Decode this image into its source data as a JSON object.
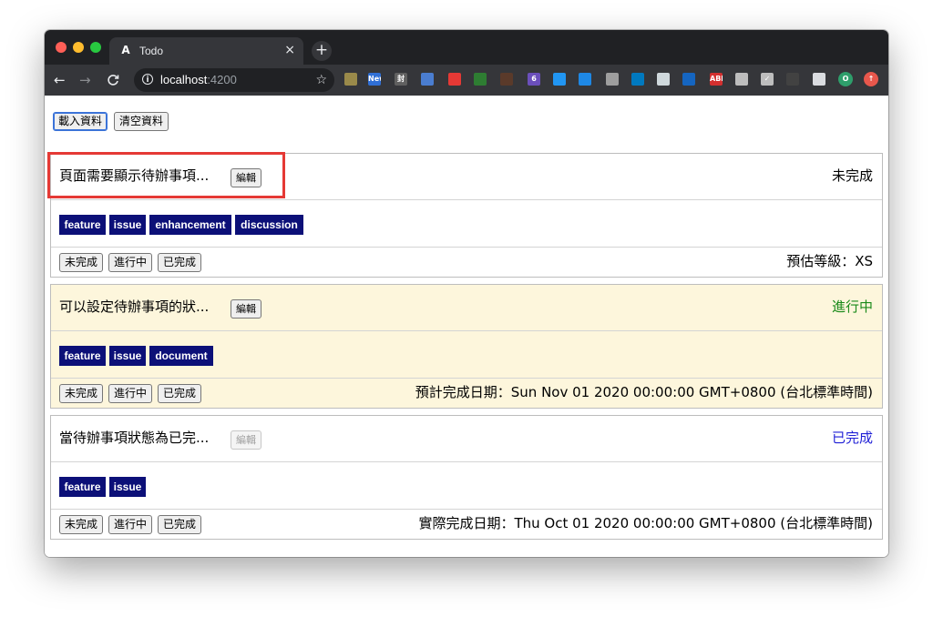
{
  "browser": {
    "tab": {
      "favicon": "angular-icon",
      "title": "Todo",
      "close": "×"
    },
    "new_tab": "+",
    "nav": {
      "back": "←",
      "forward": "→",
      "reload": "C"
    },
    "address": {
      "info": "i",
      "host": "localhost",
      "port": ":4200",
      "star": "☆"
    },
    "extensions": [
      {
        "name": "leaf-extension-icon",
        "color": "#9a8a4a",
        "label": ""
      },
      {
        "name": "new-badge-extension-icon",
        "color": "#2f6fd6",
        "label": "New"
      },
      {
        "name": "seal-extension-icon",
        "color": "#606060",
        "label": "封"
      },
      {
        "name": "card-extension-icon",
        "color": "#4a7dd0",
        "label": ""
      },
      {
        "name": "block-extension-icon",
        "color": "#e53935",
        "label": ""
      },
      {
        "name": "crop-extension-icon",
        "color": "#2e7d32",
        "label": ""
      },
      {
        "name": "cat-extension-icon",
        "color": "#5a3a2a",
        "label": ""
      },
      {
        "name": "puzzle-purple-extension-icon",
        "color": "#6b4fbb",
        "label": "6"
      },
      {
        "name": "stack-extension-icon",
        "color": "#2196f3",
        "label": ""
      },
      {
        "name": "screen-extension-icon",
        "color": "#1e88e5",
        "label": ""
      },
      {
        "name": "ghost-extension-icon",
        "color": "#9e9e9e",
        "label": ""
      },
      {
        "name": "trello-extension-icon",
        "color": "#0079bf",
        "label": ""
      },
      {
        "name": "bars-extension-icon",
        "color": "#cfd8dc",
        "label": ""
      },
      {
        "name": "trello-2-extension-icon",
        "color": "#1565c0",
        "label": ""
      },
      {
        "name": "abp-extension-icon",
        "color": "#d32f2f",
        "label": "ABP"
      },
      {
        "name": "photo-extension-icon",
        "color": "#bdbdbd",
        "label": ""
      },
      {
        "name": "check-extension-icon",
        "color": "#bdbdbd",
        "label": "✓"
      },
      {
        "name": "doc-extension-icon",
        "color": "#424242",
        "label": ""
      },
      {
        "name": "puzzle-extension-icon",
        "color": "#dadce0",
        "label": ""
      },
      {
        "name": "profile-avatar-icon",
        "color": "#2e9e6b",
        "label": "O"
      },
      {
        "name": "update-arrow-icon",
        "color": "#e8574c",
        "label": "↑"
      }
    ]
  },
  "toolbar": {
    "load_label": "載入資料",
    "clear_label": "清空資料"
  },
  "footer_labels": {
    "todo": "未完成",
    "doing": "進行中",
    "done": "已完成"
  },
  "edit_label": "編輯",
  "todos": [
    {
      "title": "頁面需要顯示待辦事項...",
      "status": "未完成",
      "status_color": "#000000",
      "tags": [
        "feature",
        "issue",
        "enhancement",
        "discussion"
      ],
      "info": "預估等級：XS",
      "edit_enabled": true
    },
    {
      "title": "可以設定待辦事項的狀...",
      "status": "進行中",
      "status_color": "#1a8a1a",
      "tags": [
        "feature",
        "issue",
        "document"
      ],
      "info": "預計完成日期：Sun Nov 01 2020 00:00:00 GMT+0800 (台北標準時間)",
      "edit_enabled": true
    },
    {
      "title": "當待辦事項狀態為已完...",
      "status": "已完成",
      "status_color": "#1f1fd6",
      "tags": [
        "feature",
        "issue"
      ],
      "info": "實際完成日期：Thu Oct 01 2020 00:00:00 GMT+0800 (台北標準時間)",
      "edit_enabled": false
    }
  ],
  "colors": {
    "tag_bg": "#0c1078",
    "doing_card_bg": "#fdf6dc",
    "highlight": "#e53935"
  }
}
